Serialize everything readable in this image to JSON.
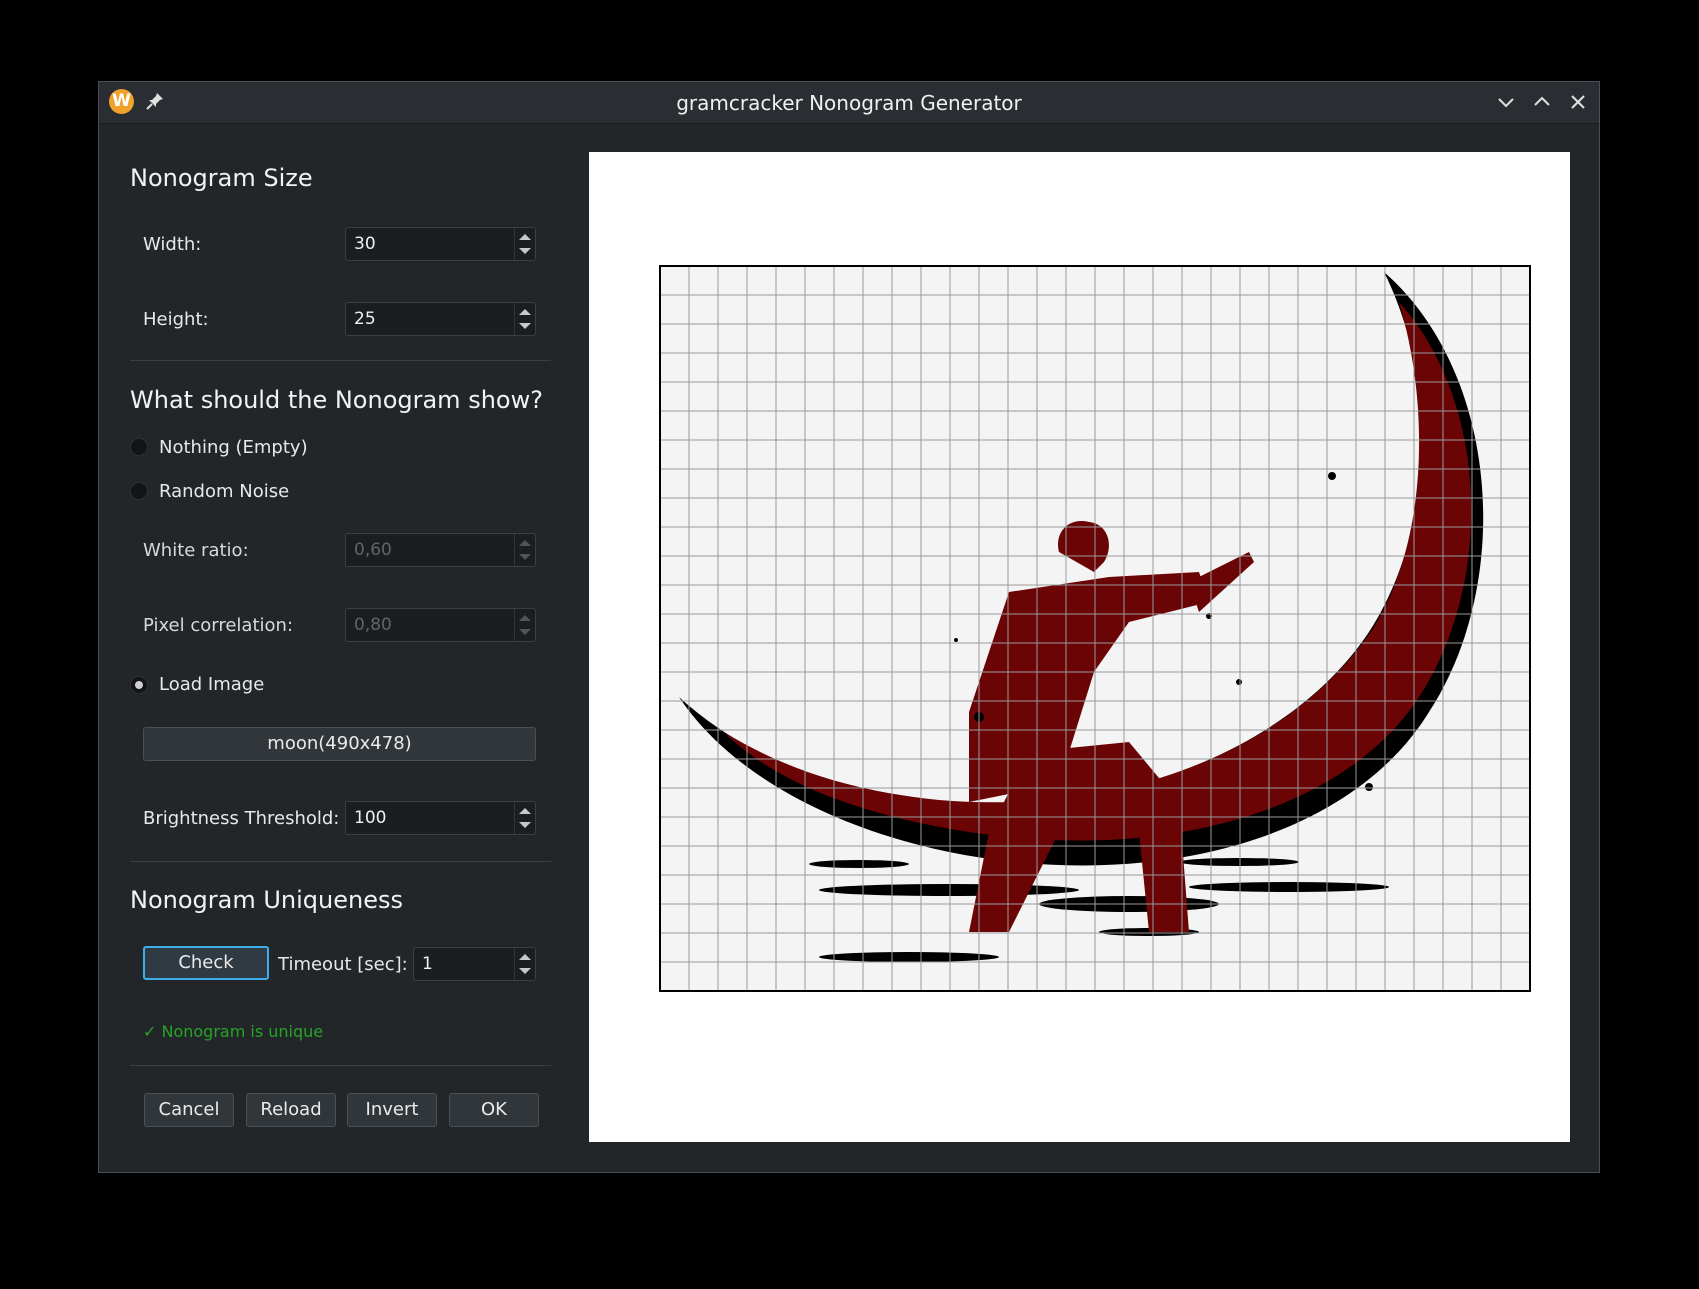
{
  "window": {
    "title": "gramcracker Nonogram Generator",
    "app_icon_letter": "W"
  },
  "size_section": {
    "heading": "Nonogram Size",
    "width_label": "Width:",
    "width_value": "30",
    "height_label": "Height:",
    "height_value": "25"
  },
  "content_section": {
    "heading": "What should the Nonogram show?",
    "option_empty": "Nothing (Empty)",
    "option_noise": "Random Noise",
    "white_ratio_label": "White ratio:",
    "white_ratio_value": "0,60",
    "pixel_corr_label": "Pixel correlation:",
    "pixel_corr_value": "0,80",
    "option_image": "Load Image",
    "selected_option": "Load Image",
    "image_button": "moon(490x478)",
    "threshold_label": "Brightness Threshold:",
    "threshold_value": "100"
  },
  "uniqueness_section": {
    "heading": "Nonogram Uniqueness",
    "check_button": "Check",
    "timeout_label": "Timeout [sec]:",
    "timeout_value": "1",
    "status": "✓ Nonogram is unique"
  },
  "buttons": {
    "cancel": "Cancel",
    "reload": "Reload",
    "invert": "Invert",
    "ok": "OK"
  },
  "preview": {
    "grid_columns": 30,
    "grid_rows": 25,
    "fill_color": "#6b0505",
    "silhouette_color": "#000000",
    "grid_color": "#9a9a9a",
    "image_name": "moon"
  }
}
